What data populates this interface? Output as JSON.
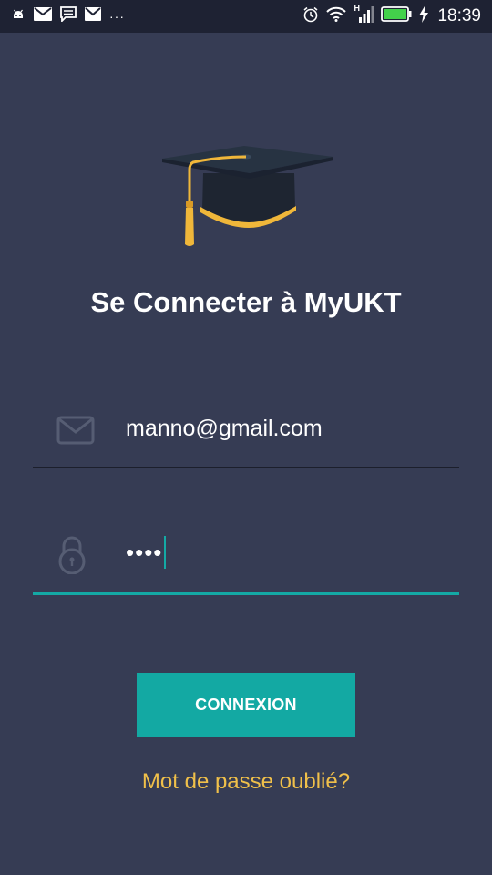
{
  "status_bar": {
    "time": "18:39",
    "overflow_indicator": "···",
    "left_icons": [
      "android-icon",
      "mail-icon",
      "message-icon",
      "mail-icon"
    ],
    "right_icons": [
      "alarm-icon",
      "wifi-icon",
      "signal-icon",
      "battery-icon",
      "charging-icon"
    ],
    "network_label": "H"
  },
  "app": {
    "logo_icon": "graduation-cap-icon",
    "title": "Se Connecter à MyUKT"
  },
  "login_form": {
    "email": {
      "value": "manno@gmail.com",
      "icon": "mail-icon"
    },
    "password": {
      "masked_value": "••••",
      "icon": "lock-icon",
      "focused": true
    },
    "submit_label": "CONNEXION",
    "forgot_label": "Mot de passe oublié?"
  },
  "colors": {
    "background": "#363c54",
    "status_bar": "#1e2233",
    "accent": "#13a9a3",
    "link": "#f0c04a",
    "cap_gold": "#f0b73a"
  }
}
